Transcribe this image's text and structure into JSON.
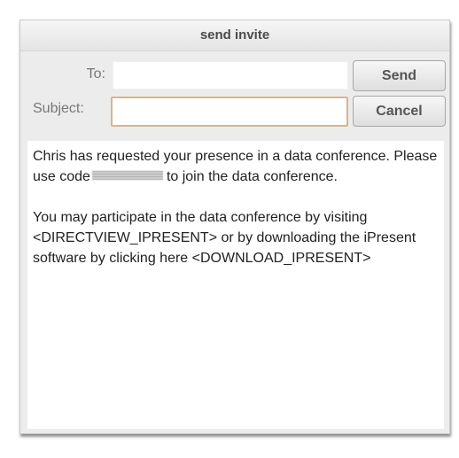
{
  "dialog": {
    "title": "send invite"
  },
  "form": {
    "to_label": "To:",
    "to_value": "",
    "subject_label": "Subject:",
    "subject_value": ""
  },
  "buttons": {
    "send_label": "Send",
    "cancel_label": "Cancel"
  },
  "message": {
    "p1_before_code": "Chris has requested your presence in a data conference.  Please use code",
    "p1_after_code": "to join the data conference.",
    "p2": "You may participate in the data conference by visiting <DIRECTVIEW_IPRESENT> or by downloading the iPresent software by clicking here <DOWNLOAD_IPRESENT>"
  }
}
